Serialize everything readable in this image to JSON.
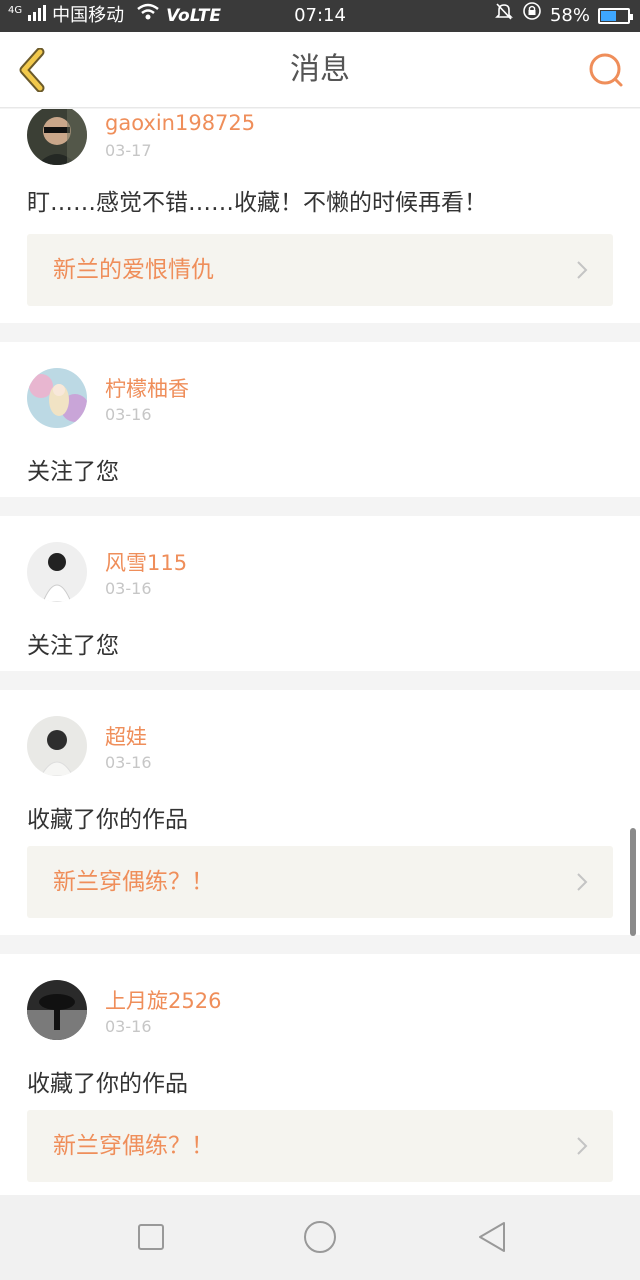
{
  "status_bar": {
    "carrier": "中国移动",
    "network": "4G",
    "volte": "VoLTE",
    "time": "07:14",
    "battery": "58%",
    "battery_level": 0.58,
    "battery_color": "#3ea7ff"
  },
  "header": {
    "title": "消息",
    "back_icon": "chevron-left-icon",
    "search_icon": "search-icon",
    "accent_color": "#ef8e5a",
    "back_color": "#f2c94c"
  },
  "messages": [
    {
      "username": "gaoxin198725",
      "date": "03-17",
      "text": "盯……感觉不错……收藏！不懒的时候再看！",
      "link": "新兰的爱恨情仇"
    },
    {
      "username": "柠檬柚香",
      "date": "03-16",
      "text": "关注了您"
    },
    {
      "username": "风雪115",
      "date": "03-16",
      "text": "关注了您"
    },
    {
      "username": "超娃",
      "date": "03-16",
      "text": "收藏了你的作品",
      "link": "新兰穿偶练？！"
    },
    {
      "username": "上月旋2526",
      "date": "03-16",
      "text": "收藏了你的作品",
      "link": "新兰穿偶练？！"
    }
  ],
  "nav_bar": {
    "recents_icon": "square-icon",
    "home_icon": "circle-icon",
    "back_icon": "triangle-back-icon"
  }
}
